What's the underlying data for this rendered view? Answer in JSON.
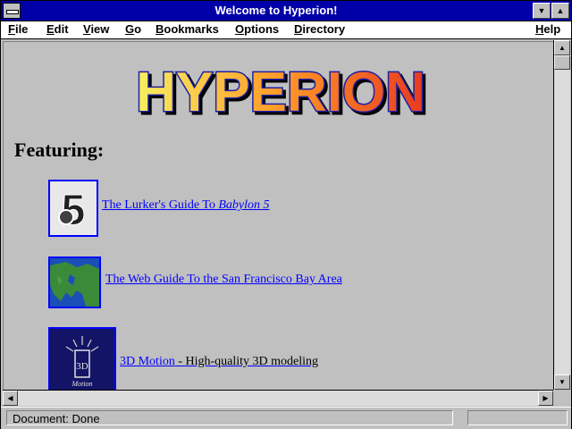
{
  "window": {
    "title": "Welcome to Hyperion!",
    "minimize_glyph": "▼",
    "maximize_glyph": "▲"
  },
  "menubar": {
    "items": [
      {
        "label": "File",
        "key": "F",
        "rest": "ile"
      },
      {
        "label": "Edit",
        "key": "E",
        "rest": "dit"
      },
      {
        "label": "View",
        "key": "V",
        "rest": "iew"
      },
      {
        "label": "Go",
        "key": "G",
        "rest": "o"
      },
      {
        "label": "Bookmarks",
        "key": "B",
        "rest": "ookmarks"
      },
      {
        "label": "Options",
        "key": "O",
        "rest": "ptions"
      },
      {
        "label": "Directory",
        "key": "D",
        "rest": "irectory"
      },
      {
        "label": "Help",
        "key": "H",
        "rest": "elp"
      }
    ]
  },
  "page": {
    "logo_text": "HYPERION",
    "featuring": "Featuring:",
    "links": [
      {
        "text": "The Lurker's Guide To ",
        "italic": "Babylon 5",
        "icon": "babylon5-logo-icon"
      },
      {
        "text": "The Web Guide To the San Francisco Bay Area",
        "icon": "bay-area-map-icon"
      },
      {
        "text": "3D Motion",
        "suffix": " - High-quality 3D modeling",
        "icon": "3d-motion-logo-icon"
      }
    ]
  },
  "scrollbars": {
    "up": "▲",
    "down": "▼",
    "left": "◀",
    "right": "▶"
  },
  "status": {
    "text": "Document: Done",
    "progress": 0
  },
  "colors": {
    "titlebar": "#0000a8",
    "link": "#0000ff",
    "background": "#c0c0c0"
  }
}
